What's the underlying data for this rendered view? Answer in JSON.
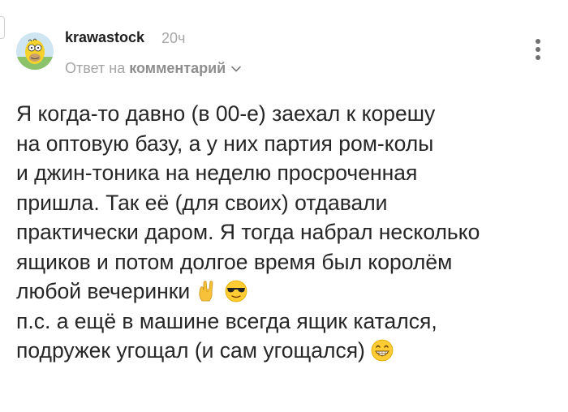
{
  "comment": {
    "username": "krawastock",
    "time": "20ч",
    "reply_prefix": "Ответ на",
    "reply_target": "комментарий",
    "body_lines": [
      "Я когда-то давно (в 00-е) заехал к корешу",
      "на оптовую базу, а у них партия ром-колы",
      "и джин-тоника на неделю просроченная",
      "пришла. Так её (для своих) отдавали",
      "практически даром. Я тогда набрал несколько",
      "ящиков и потом долгое время был королём",
      "любой вечеринки",
      "п.с. а ещё в машине всегда ящик катался,",
      "подружек угощал (и сам угощался)"
    ],
    "emojis": {
      "line_7": [
        "rock-hand-emoji",
        "sunglasses-emoji"
      ],
      "line_9": [
        "grinning-emoji"
      ]
    }
  },
  "colors": {
    "text": "#262626",
    "muted": "#a5a5a5",
    "username": "#1f1f1f"
  }
}
